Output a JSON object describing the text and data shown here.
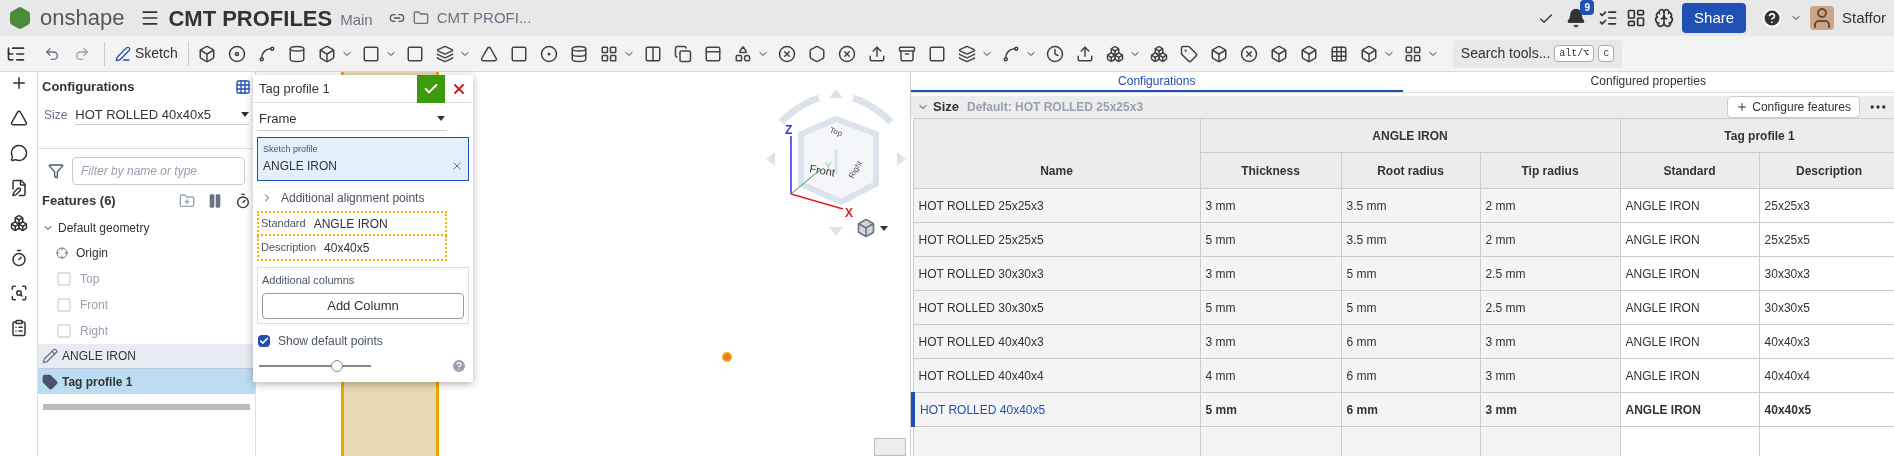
{
  "header": {
    "logo_text": "onshape",
    "document_title": "CMT PROFILES",
    "branch": "Main",
    "folder": "CMT PROFI...",
    "notification_count": "9",
    "share": "Share",
    "user": "Staffor"
  },
  "toolbar": {
    "sketch": "Sketch",
    "search": "Search tools...",
    "shortcut_keys": [
      "alt/⌥",
      "c"
    ]
  },
  "configurations_panel": {
    "title": "Configurations",
    "size_label": "Size",
    "size_value": "HOT ROLLED 40x40x5",
    "filter_placeholder": "Filter by name or type",
    "features_title": "Features (6)"
  },
  "feature_tree": [
    {
      "label": "Default geometry",
      "kind": "group",
      "expanded": true,
      "selected": false,
      "hovered": false,
      "children": [
        {
          "label": "Origin",
          "kind": "origin",
          "disabled": false
        },
        {
          "label": "Top",
          "kind": "plane",
          "disabled": true
        },
        {
          "label": "Front",
          "kind": "plane",
          "disabled": true
        },
        {
          "label": "Right",
          "kind": "plane",
          "disabled": true
        }
      ]
    },
    {
      "label": "ANGLE IRON",
      "kind": "sketch",
      "selected": false,
      "hovered": true
    },
    {
      "label": "Tag profile 1",
      "kind": "tag",
      "selected": true,
      "hovered": false
    }
  ],
  "dialog": {
    "title": "Tag profile 1",
    "type_value": "Frame",
    "sketch_profile_label": "Sketch profile",
    "sketch_profile_value": "ANGLE IRON",
    "alignment_label": "Additional alignment points",
    "alignment_expanded": false,
    "fields": [
      {
        "label": "Standard",
        "value": "ANGLE IRON"
      },
      {
        "label": "Description",
        "value": "40x40x5"
      }
    ],
    "additional_columns_label": "Additional columns",
    "add_column": "Add Column",
    "show_default_points": {
      "label": "Show default points",
      "checked": true
    },
    "slider": {
      "level": 0.7
    }
  },
  "view_cube": {
    "faces": [
      "Top",
      "Front",
      "Right"
    ],
    "axes": [
      "Z",
      "Y",
      "X"
    ]
  },
  "right_panel": {
    "tabs": [
      {
        "label": "Configurations",
        "selected": true
      },
      {
        "label": "Configured properties",
        "selected": false
      }
    ],
    "size_header": {
      "name": "Size",
      "default": "Default: HOT ROLLED 25x25x3",
      "configure": "Configure features"
    },
    "table": {
      "name_column": "Name",
      "column_groups": [
        {
          "label": "ANGLE IRON",
          "columns": [
            "Thickness",
            "Root radius",
            "Tip radius"
          ]
        },
        {
          "label": "Tag profile 1",
          "columns": [
            "Standard",
            "Description"
          ]
        }
      ],
      "rows": [
        {
          "cells": [
            "HOT ROLLED 25x25x3",
            "3 mm",
            "3.5 mm",
            "2 mm",
            "ANGLE IRON",
            "25x25x3"
          ],
          "selected": false
        },
        {
          "cells": [
            "HOT ROLLED 25x25x5",
            "5 mm",
            "3.5 mm",
            "2 mm",
            "ANGLE IRON",
            "25x25x5"
          ],
          "selected": false
        },
        {
          "cells": [
            "HOT ROLLED 30x30x3",
            "3 mm",
            "5 mm",
            "2.5 mm",
            "ANGLE IRON",
            "30x30x3"
          ],
          "selected": false
        },
        {
          "cells": [
            "HOT ROLLED 30x30x5",
            "5 mm",
            "5 mm",
            "2.5 mm",
            "ANGLE IRON",
            "30x30x5"
          ],
          "selected": false
        },
        {
          "cells": [
            "HOT ROLLED 40x40x3",
            "3 mm",
            "6 mm",
            "3 mm",
            "ANGLE IRON",
            "40x40x3"
          ],
          "selected": false
        },
        {
          "cells": [
            "HOT ROLLED 40x40x4",
            "4 mm",
            "6 mm",
            "3 mm",
            "ANGLE IRON",
            "40x40x4"
          ],
          "selected": false
        },
        {
          "cells": [
            "HOT ROLLED 40x40x5",
            "5 mm",
            "6 mm",
            "3 mm",
            "ANGLE IRON",
            "40x40x5"
          ],
          "selected": true
        }
      ]
    }
  }
}
